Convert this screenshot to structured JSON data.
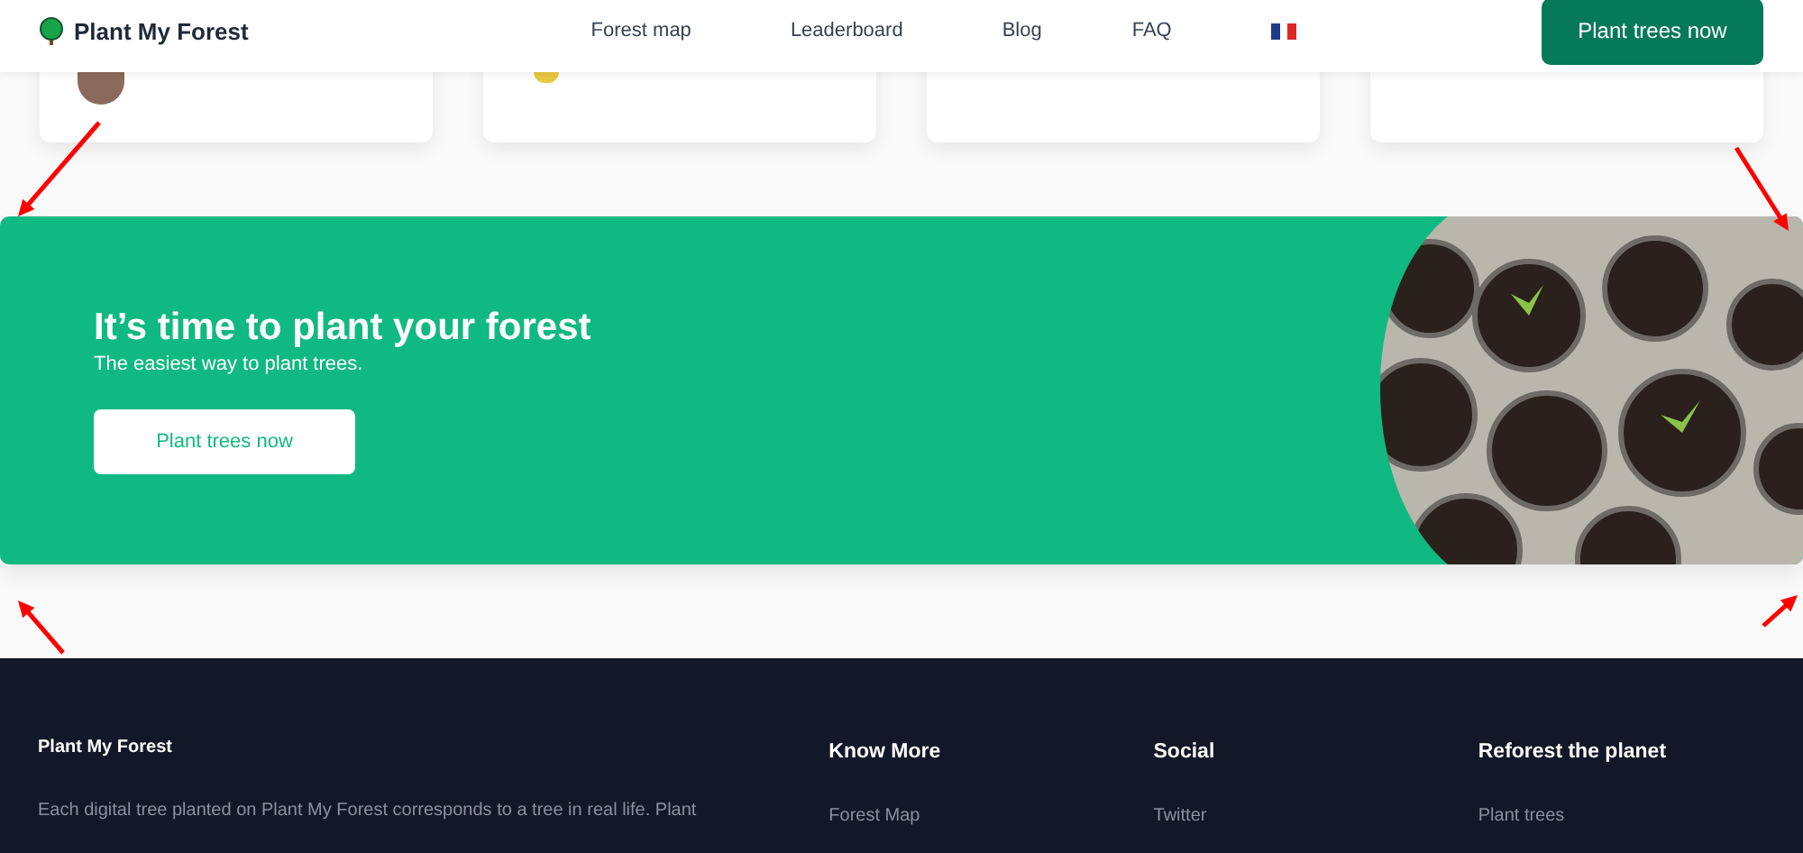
{
  "nav": {
    "brand": "Plant My Forest",
    "links": [
      "Forest map",
      "Leaderboard",
      "Blog",
      "FAQ"
    ],
    "cta": "Plant trees now"
  },
  "banner": {
    "title": "It’s time to plant your forest",
    "subtitle": "The easiest way to plant trees.",
    "button": "Plant trees now"
  },
  "footer": {
    "brand": "Plant My Forest",
    "description": "Each digital tree planted on Plant My Forest corresponds to a tree in real life. Plant",
    "columns": [
      {
        "heading": "Know More",
        "links": [
          "Forest Map"
        ]
      },
      {
        "heading": "Social",
        "links": [
          "Twitter"
        ]
      },
      {
        "heading": "Reforest the planet",
        "links": [
          "Plant trees"
        ]
      }
    ]
  }
}
